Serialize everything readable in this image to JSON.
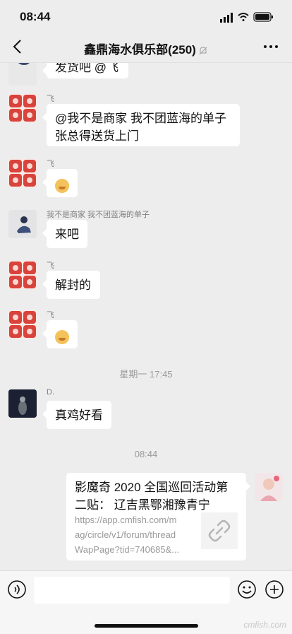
{
  "status_bar": {
    "time": "08:44"
  },
  "nav": {
    "title": "鑫鼎海水俱乐部(250)"
  },
  "messages": [
    {
      "text": "发货吧 @飞"
    },
    {
      "sender": "飞",
      "line1": "@我不是商家 我不团蓝海的单子",
      "line2": "张总得送货上门"
    },
    {
      "sender": "飞",
      "emoji": "grin-emoji"
    },
    {
      "sender": "我不是商家 我不团蓝海的单子",
      "text": "来吧"
    },
    {
      "sender": "飞",
      "text": "解封的"
    },
    {
      "sender": "飞",
      "emoji": "smirk-emoji"
    },
    {
      "sender": "D.",
      "text": "真鸡好看"
    }
  ],
  "timestamps": {
    "t1": "星期一 17:45",
    "t2": "08:44"
  },
  "link_card": {
    "title_line1": "影魔奇 2020 全国巡回活动第",
    "title_line2": "二贴： 辽吉黑鄂湘豫青宁",
    "url_line1": "https://app.cmfish.com/m",
    "url_line2": "ag/circle/v1/forum/thread",
    "url_line3": "WapPage?tid=740685&..."
  },
  "watermark": "cmfish.com",
  "colors": {
    "background": "#ededed",
    "bubble": "#ffffff",
    "meta_text": "#9a9a9a",
    "avatar_red": "#d9433b"
  }
}
